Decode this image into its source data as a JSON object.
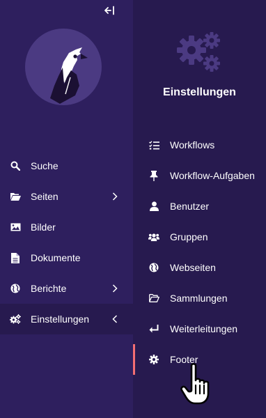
{
  "sidebar": {
    "collapse_icon": "arrow-left-to-bar-icon",
    "logo_icon": "bird-logo",
    "items": [
      {
        "label": "Suche",
        "icon": "search-icon",
        "has_children": false
      },
      {
        "label": "Seiten",
        "icon": "folder-open-icon",
        "has_children": true
      },
      {
        "label": "Bilder",
        "icon": "image-icon",
        "has_children": false
      },
      {
        "label": "Dokumente",
        "icon": "document-icon",
        "has_children": false
      },
      {
        "label": "Berichte",
        "icon": "globe-icon",
        "has_children": true
      },
      {
        "label": "Einstellungen",
        "icon": "cogs-icon",
        "has_children": true,
        "active": true
      }
    ]
  },
  "submenu": {
    "header_icon": "cogs-icon",
    "title": "Einstellungen",
    "items": [
      {
        "label": "Workflows",
        "icon": "tasks-icon"
      },
      {
        "label": "Workflow-Aufgaben",
        "icon": "thumbtack-icon"
      },
      {
        "label": "Benutzer",
        "icon": "user-icon"
      },
      {
        "label": "Gruppen",
        "icon": "users-icon"
      },
      {
        "label": "Webseiten",
        "icon": "globe-icon"
      },
      {
        "label": "Sammlungen",
        "icon": "folder-open-icon"
      },
      {
        "label": "Weiterleitungen",
        "icon": "redirect-arrow-icon"
      },
      {
        "label": "Footer",
        "icon": "gear-icon",
        "hovered": true
      }
    ]
  },
  "colors": {
    "sidebar_bg": "#2e1f5e",
    "submenu_bg": "#271a4f",
    "logo_circle": "#4b3a82",
    "hover_accent": "#f36e73",
    "icon_muted": "#4b3a82",
    "text": "#ffffff"
  }
}
